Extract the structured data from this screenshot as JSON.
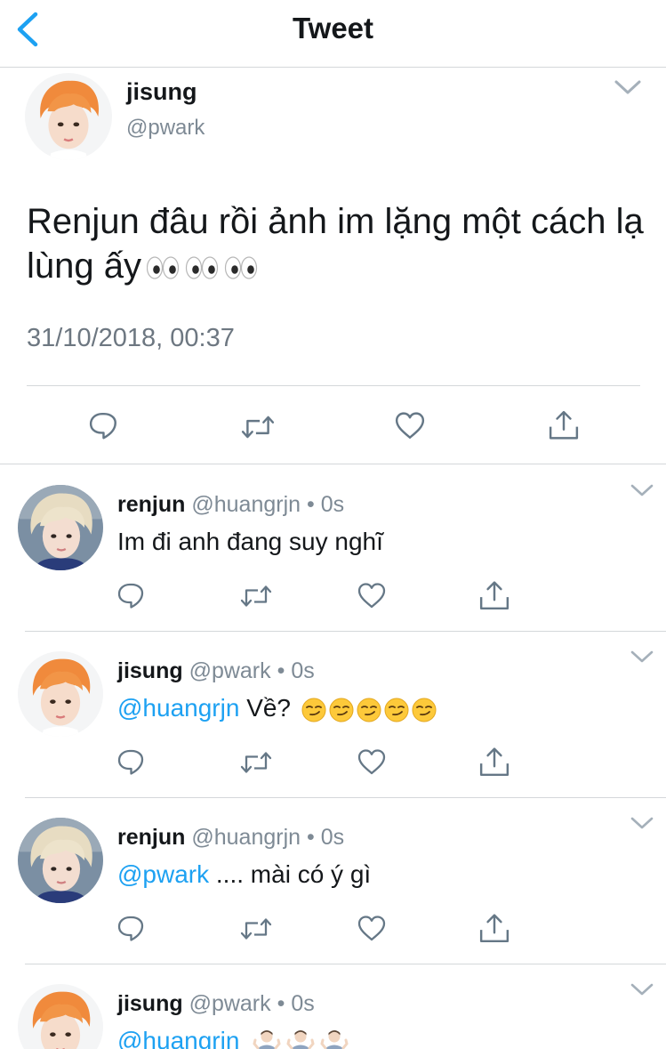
{
  "nav": {
    "title": "Tweet"
  },
  "main_tweet": {
    "name": "jisung",
    "handle": "@pwark",
    "text": "Renjun đâu rồi ảnh im lặng một cách lạ lùng ấy",
    "timestamp": "31/10/2018, 00:37"
  },
  "replies": [
    {
      "name": "renjun",
      "handle": "@huangrjn",
      "dot": "•",
      "time": "0s",
      "mention": "",
      "text": "Im đi anh đang suy nghĩ",
      "avatar": "renjun"
    },
    {
      "name": "jisung",
      "handle": "@pwark",
      "dot": "•",
      "time": "0s",
      "mention": "@huangrjn",
      "text": "Về?",
      "avatar": "jisung"
    },
    {
      "name": "renjun",
      "handle": "@huangrjn",
      "dot": "•",
      "time": "0s",
      "mention": "@pwark",
      "text": ".... mài có ý gì",
      "avatar": "renjun"
    },
    {
      "name": "jisung",
      "handle": "@pwark",
      "dot": "•",
      "time": "0s",
      "mention": "@huangrjn",
      "text": "",
      "avatar": "jisung"
    }
  ],
  "icons": {
    "back": "chevron-left-icon",
    "menu": "chevron-down-icon",
    "reply": "reply-icon",
    "retweet": "retweet-icon",
    "like": "heart-icon",
    "share": "share-icon",
    "eyes": "eyes-emoji",
    "smirk": "smirking-face-emoji",
    "shrug": "man-shrugging-emoji"
  },
  "colors": {
    "accent": "#1da1f2",
    "icon_gray": "#657786",
    "text": "#14171a",
    "muted": "#7e8a95",
    "divider": "#d4d7da"
  }
}
